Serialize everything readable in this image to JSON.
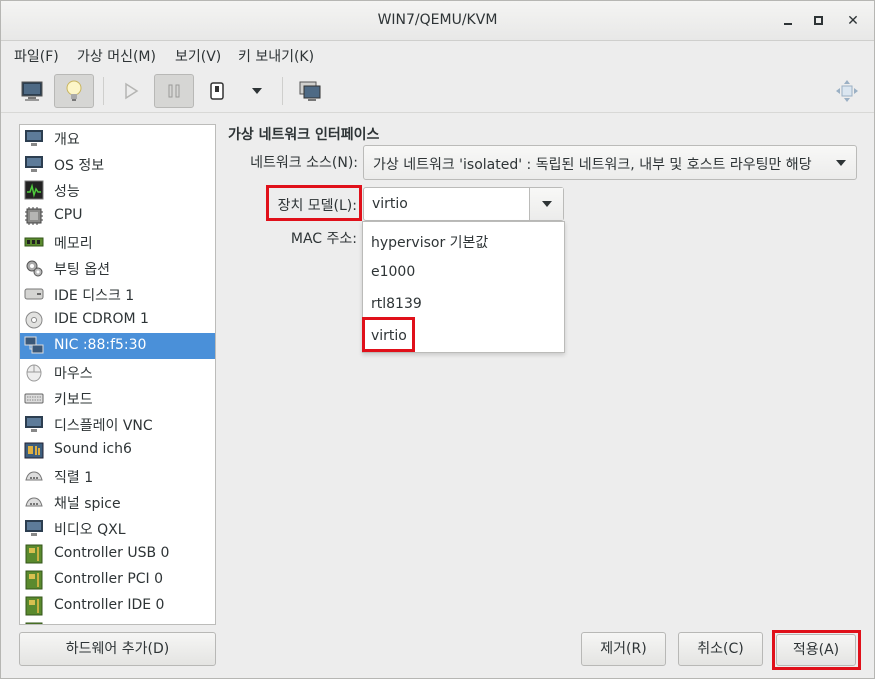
{
  "window": {
    "title": "WIN7/QEMU/KVM"
  },
  "menu": [
    {
      "label": "파일(F)"
    },
    {
      "label": "가상 머신(M)"
    },
    {
      "label": "보기(V)"
    },
    {
      "label": "키 보내기(K)"
    }
  ],
  "toolbar": {
    "buttons": [
      "monitor-icon",
      "lightbulb-icon",
      "play-icon",
      "pause-icon",
      "power-icon",
      "dropdown-arrow-icon",
      "snapshot-icon",
      "fullscreen-icon"
    ],
    "pressed": [
      "lightbulb-icon",
      "pause-icon"
    ]
  },
  "sidebar": {
    "items": [
      {
        "label": "개요",
        "icon": "monitor-icon"
      },
      {
        "label": "OS 정보",
        "icon": "monitor-icon"
      },
      {
        "label": "성능",
        "icon": "performance-icon"
      },
      {
        "label": "CPU",
        "icon": "cpu-icon"
      },
      {
        "label": "메모리",
        "icon": "memory-icon"
      },
      {
        "label": "부팅 옵션",
        "icon": "gear-icon"
      },
      {
        "label": "IDE 디스크 1",
        "icon": "disk-icon"
      },
      {
        "label": "IDE CDROM 1",
        "icon": "cdrom-icon"
      },
      {
        "label": "NIC :88:f5:30",
        "icon": "network-icon",
        "selected": true
      },
      {
        "label": "마우스",
        "icon": "mouse-icon"
      },
      {
        "label": "키보드",
        "icon": "keyboard-icon"
      },
      {
        "label": "디스플레이 VNC",
        "icon": "monitor-icon"
      },
      {
        "label": "Sound ich6",
        "icon": "sound-icon"
      },
      {
        "label": "직렬 1",
        "icon": "serial-icon"
      },
      {
        "label": "채널 spice",
        "icon": "serial-icon"
      },
      {
        "label": "비디오 QXL",
        "icon": "monitor-icon"
      },
      {
        "label": "Controller USB 0",
        "icon": "controller-icon"
      },
      {
        "label": "Controller PCI 0",
        "icon": "controller-icon"
      },
      {
        "label": "Controller IDE 0",
        "icon": "controller-icon"
      }
    ],
    "add_hardware_label": "하드웨어 추가(D)"
  },
  "panel": {
    "title": "가상 네트워크 인터페이스",
    "network_source_label": "네트워크 소스(N):",
    "network_source_value": "가상 네트워크 'isolated' : 독립된 네트워크, 내부 및 호스트 라우팅만 해당",
    "device_model_label": "장치 모델(L):",
    "device_model_value": "virtio",
    "mac_label": "MAC 주소:",
    "model_options": [
      "hypervisor 기본값",
      "e1000",
      "rtl8139",
      "virtio"
    ]
  },
  "buttons": {
    "remove": "제거(R)",
    "cancel": "취소(C)",
    "apply": "적용(A)"
  },
  "colors": {
    "highlight": "#e0101a",
    "selection": "#4a90d9"
  }
}
